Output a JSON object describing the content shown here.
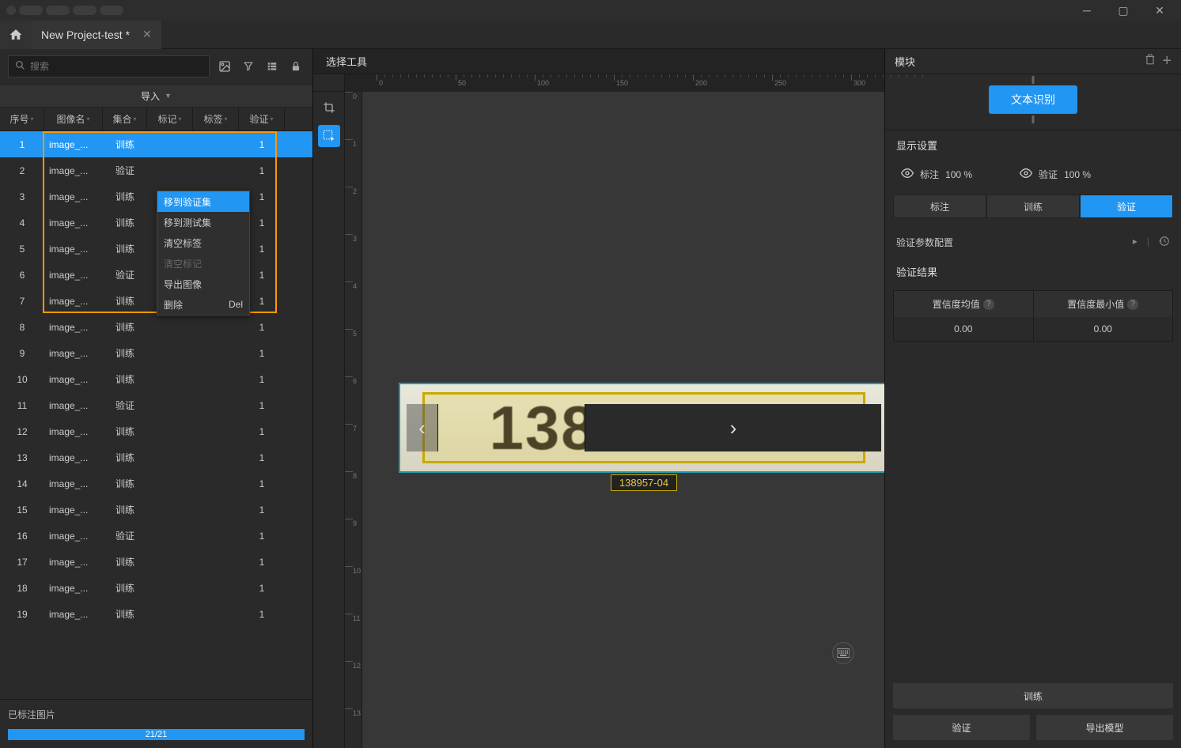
{
  "tab_title": "New Project-test *",
  "search_placeholder": "搜索",
  "import_label": "导入",
  "columns": {
    "idx": "序号",
    "name": "图像名",
    "set": "集合",
    "mark": "标记",
    "tag": "标签",
    "ver": "验证"
  },
  "rows": [
    {
      "idx": "1",
      "name": "image_...",
      "set": "训练",
      "mark": "",
      "tag": "",
      "ver": "1",
      "sel": true
    },
    {
      "idx": "2",
      "name": "image_...",
      "set": "验证",
      "mark": "",
      "tag": "",
      "ver": "1"
    },
    {
      "idx": "3",
      "name": "image_...",
      "set": "训练",
      "mark": "",
      "tag": "",
      "ver": "1"
    },
    {
      "idx": "4",
      "name": "image_...",
      "set": "训练",
      "mark": "",
      "tag": "",
      "ver": "1"
    },
    {
      "idx": "5",
      "name": "image_...",
      "set": "训练",
      "mark": "",
      "tag": "",
      "ver": "1"
    },
    {
      "idx": "6",
      "name": "image_...",
      "set": "验证",
      "mark": "",
      "tag": "",
      "ver": "1"
    },
    {
      "idx": "7",
      "name": "image_...",
      "set": "训练",
      "mark": "",
      "tag": "",
      "ver": "1"
    },
    {
      "idx": "8",
      "name": "image_...",
      "set": "训练",
      "mark": "",
      "tag": "",
      "ver": "1"
    },
    {
      "idx": "9",
      "name": "image_...",
      "set": "训练",
      "mark": "",
      "tag": "",
      "ver": "1"
    },
    {
      "idx": "10",
      "name": "image_...",
      "set": "训练",
      "mark": "",
      "tag": "",
      "ver": "1"
    },
    {
      "idx": "11",
      "name": "image_...",
      "set": "验证",
      "mark": "",
      "tag": "",
      "ver": "1"
    },
    {
      "idx": "12",
      "name": "image_...",
      "set": "训练",
      "mark": "",
      "tag": "",
      "ver": "1"
    },
    {
      "idx": "13",
      "name": "image_...",
      "set": "训练",
      "mark": "",
      "tag": "",
      "ver": "1"
    },
    {
      "idx": "14",
      "name": "image_...",
      "set": "训练",
      "mark": "",
      "tag": "",
      "ver": "1"
    },
    {
      "idx": "15",
      "name": "image_...",
      "set": "训练",
      "mark": "",
      "tag": "",
      "ver": "1"
    },
    {
      "idx": "16",
      "name": "image_...",
      "set": "验证",
      "mark": "",
      "tag": "",
      "ver": "1"
    },
    {
      "idx": "17",
      "name": "image_...",
      "set": "训练",
      "mark": "",
      "tag": "",
      "ver": "1"
    },
    {
      "idx": "18",
      "name": "image_...",
      "set": "训练",
      "mark": "",
      "tag": "",
      "ver": "1"
    },
    {
      "idx": "19",
      "name": "image_...",
      "set": "训练",
      "mark": "",
      "tag": "",
      "ver": "1"
    }
  ],
  "ctx": {
    "move_val": "移到验证集",
    "move_test": "移到测试集",
    "clear_tag": "清空标签",
    "clear_mark": "清空标记",
    "export_img": "导出图像",
    "delete": "删除",
    "del_key": "Del"
  },
  "labeled_images": "已标注图片",
  "progress": "21/21",
  "center_title": "选择工具",
  "ocr_text": "138957-04",
  "ocr_label": "138957-04",
  "right": {
    "module": "模块",
    "chip": "文本识别",
    "display": "显示设置",
    "annot": "标注",
    "verify": "验证",
    "pct": "100 %",
    "tabs": {
      "a": "标注",
      "b": "训练",
      "c": "验证"
    },
    "cfg": "验证参数配置",
    "result": "验证结果",
    "th1": "置信度均值",
    "th2": "置信度最小值",
    "v1": "0.00",
    "v2": "0.00",
    "train_btn": "训练",
    "verify_btn": "验证",
    "export_btn": "导出模型"
  },
  "ruler_h": [
    "0",
    "50",
    "100",
    "150",
    "200",
    "250",
    "300"
  ],
  "ruler_v": [
    "0",
    "1",
    "2",
    "3",
    "4",
    "5",
    "6",
    "7",
    "8",
    "9",
    "10",
    "11",
    "12",
    "13"
  ]
}
